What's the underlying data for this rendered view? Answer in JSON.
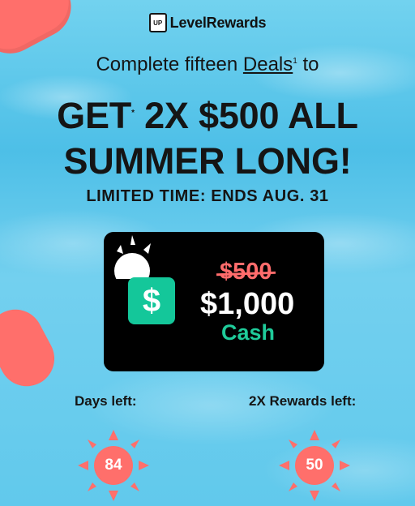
{
  "brand": {
    "name": "LevelRewards",
    "badge": "UP"
  },
  "promo": {
    "intro_prefix": "Complete fifteen ",
    "intro_link": "Deals",
    "intro_suffix": " to",
    "intro_sup": "1",
    "headline_line1": "GET",
    "headline_line1_sup": "*",
    "headline_line1_rest": "2X $500 ALL",
    "headline_line2": "SUMMER LONG!",
    "limited": "LIMITED TIME: ENDS AUG. 31"
  },
  "card": {
    "icon_symbol": "$",
    "old_amount": "$500",
    "new_amount": "$1,000",
    "payout": "Cash"
  },
  "stats": {
    "days_label": "Days left:",
    "days_value": "84",
    "rewards_label": "2X Rewards left:",
    "rewards_value": "50"
  },
  "colors": {
    "pool": "#5fc5e8",
    "float": "#ff6f6b",
    "sun": "#ff6f6b",
    "cash_app": "#14c79a"
  }
}
